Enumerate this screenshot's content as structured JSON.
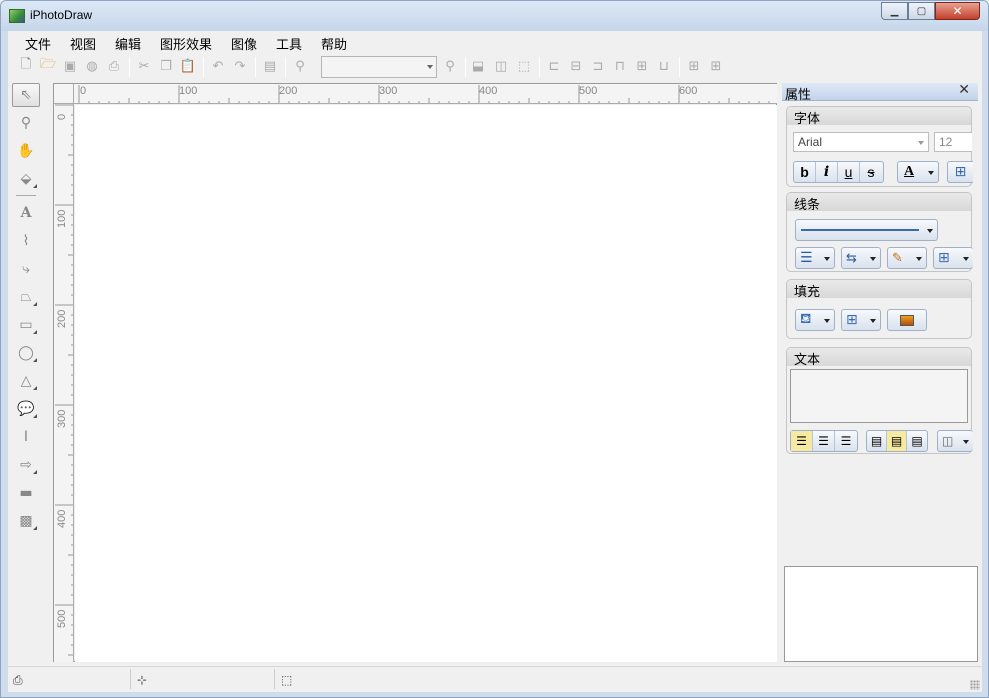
{
  "window": {
    "title": "iPhotoDraw"
  },
  "menu": [
    "文件",
    "视图",
    "编辑",
    "图形效果",
    "图像",
    "工具",
    "帮助"
  ],
  "toolbar": {
    "zoom_value": ""
  },
  "ruler": {
    "h_labels": [
      "0",
      "100",
      "200",
      "300",
      "400",
      "500",
      "600"
    ],
    "v_labels": [
      "0",
      "100",
      "200",
      "300",
      "400",
      "500"
    ]
  },
  "properties": {
    "title": "属性",
    "font_group": {
      "title": "字体",
      "font_name": "Arial",
      "font_size": "12",
      "bold": "b",
      "italic": "i",
      "underline": "u",
      "strike": "s",
      "color_label": "A"
    },
    "line_group": {
      "title": "线条"
    },
    "fill_group": {
      "title": "填充"
    },
    "text_group": {
      "title": "文本",
      "text_value": ""
    }
  },
  "icons": {
    "window": [
      "app-icon",
      "minimize-icon",
      "maximize-icon",
      "close-icon"
    ],
    "tools": [
      "select-arrow-icon",
      "zoom-icon",
      "hand-pan-icon",
      "node-edit-icon",
      "text-icon",
      "polyline-icon",
      "connector-icon",
      "polygon-icon",
      "rectangle-icon",
      "ellipse-icon",
      "triangle-icon",
      "callout-icon",
      "dimension-icon",
      "arrow-shape-icon",
      "image-icon",
      "mosaic-icon"
    ]
  }
}
